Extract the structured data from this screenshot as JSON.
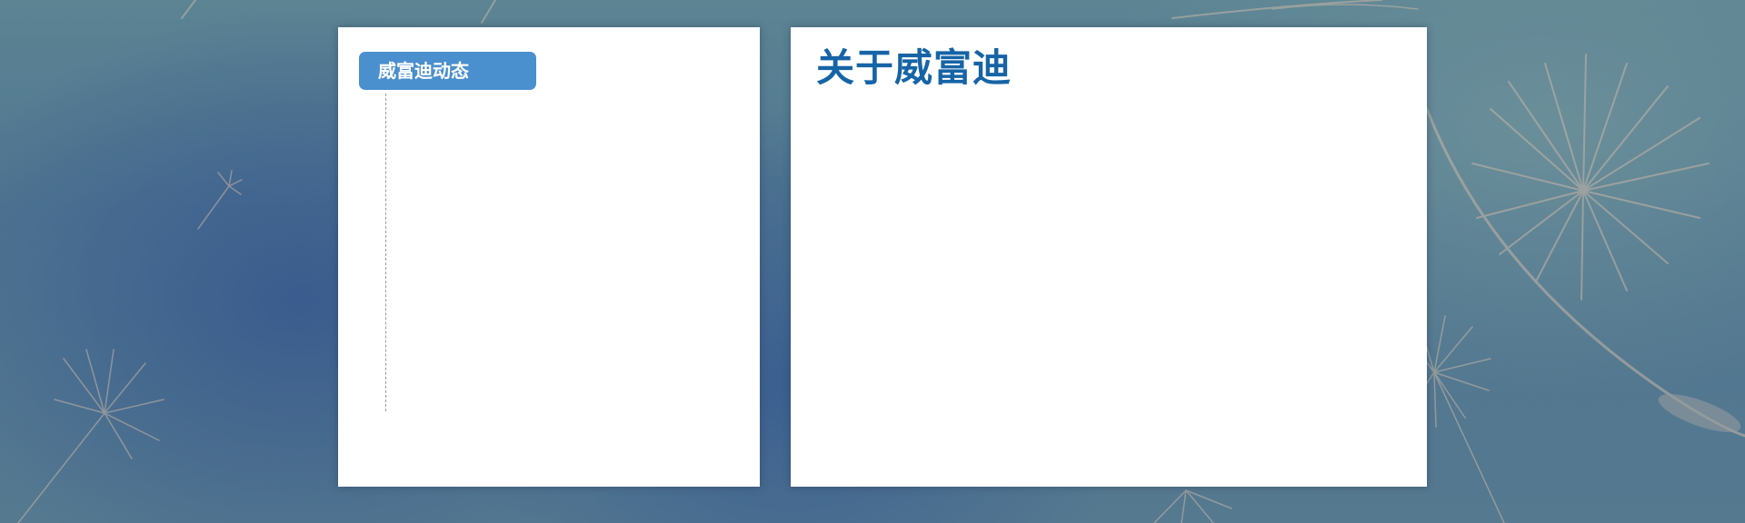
{
  "left_panel": {
    "tab_label": "威富迪动态"
  },
  "right_panel": {
    "title": "关于威富迪"
  },
  "background": {
    "motif": "dandelion-seeds",
    "base_color": "#4f7590",
    "accent_color": "#3a5c8e",
    "seed_color": "#c8b6a6"
  },
  "colors": {
    "tab_background": "#4a8fce",
    "title_text": "#1664a6",
    "panel_background": "#ffffff"
  }
}
